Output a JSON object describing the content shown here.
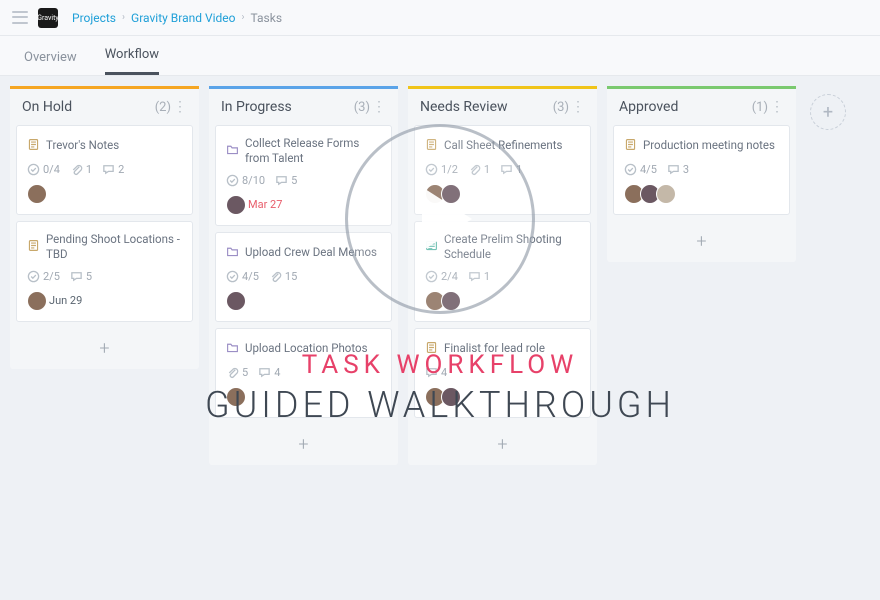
{
  "brand": "Gravity",
  "breadcrumb": {
    "projects": "Projects",
    "project": "Gravity Brand Video",
    "current": "Tasks"
  },
  "tabs": {
    "overview": "Overview",
    "workflow": "Workflow"
  },
  "columns": [
    {
      "id": "on-hold",
      "title": "On Hold",
      "count": "(2)",
      "color": "#f5a623",
      "cards": [
        {
          "icon": "note",
          "title": "Trevor's Notes",
          "check": "0/4",
          "attach": "1",
          "comment": "2",
          "avatars": [
            "a1"
          ]
        },
        {
          "icon": "note",
          "title": "Pending Shoot Locations - TBD",
          "check": "2/5",
          "comment": "5",
          "avatars": [
            "a1"
          ],
          "date": "Jun 29",
          "dateClass": ""
        }
      ]
    },
    {
      "id": "in-progress",
      "title": "In Progress",
      "count": "(3)",
      "color": "#5aa3e8",
      "cards": [
        {
          "icon": "folder",
          "title": "Collect Release Forms from Talent",
          "check": "8/10",
          "comment": "5",
          "avatars": [
            "a2"
          ],
          "date": "Mar 27",
          "dateClass": "red"
        },
        {
          "icon": "folder",
          "title": "Upload Crew Deal Memos",
          "check": "4/5",
          "attach": "15",
          "avatars": [
            "a2"
          ]
        },
        {
          "icon": "folder",
          "title": "Upload Location Photos",
          "attach": "5",
          "comment": "4",
          "avatars": [
            "a1"
          ]
        }
      ]
    },
    {
      "id": "needs-review",
      "title": "Needs Review",
      "count": "(3)",
      "color": "#f0c419",
      "cards": [
        {
          "icon": "note",
          "title": "Call Sheet Refinements",
          "check": "1/2",
          "attach": "1",
          "comment": "1",
          "avatars": [
            "a1",
            "a2"
          ]
        },
        {
          "icon": "list",
          "title": "Create Prelim Shooting Schedule",
          "check": "2/4",
          "comment": "1",
          "avatars": [
            "a1",
            "a2"
          ]
        },
        {
          "icon": "note",
          "title": "Finalist for lead role",
          "comment": "4",
          "avatars": [
            "a1",
            "a2"
          ]
        }
      ]
    },
    {
      "id": "approved",
      "title": "Approved",
      "count": "(1)",
      "color": "#7ac96f",
      "cards": [
        {
          "icon": "note",
          "title": "Production meeting notes",
          "check": "4/5",
          "comment": "3",
          "avatars": [
            "a1",
            "a2",
            "a3"
          ]
        }
      ]
    }
  ],
  "overlay": {
    "title": "TASK WORKFLOW",
    "subtitle": "GUIDED WALKTHROUGH"
  }
}
